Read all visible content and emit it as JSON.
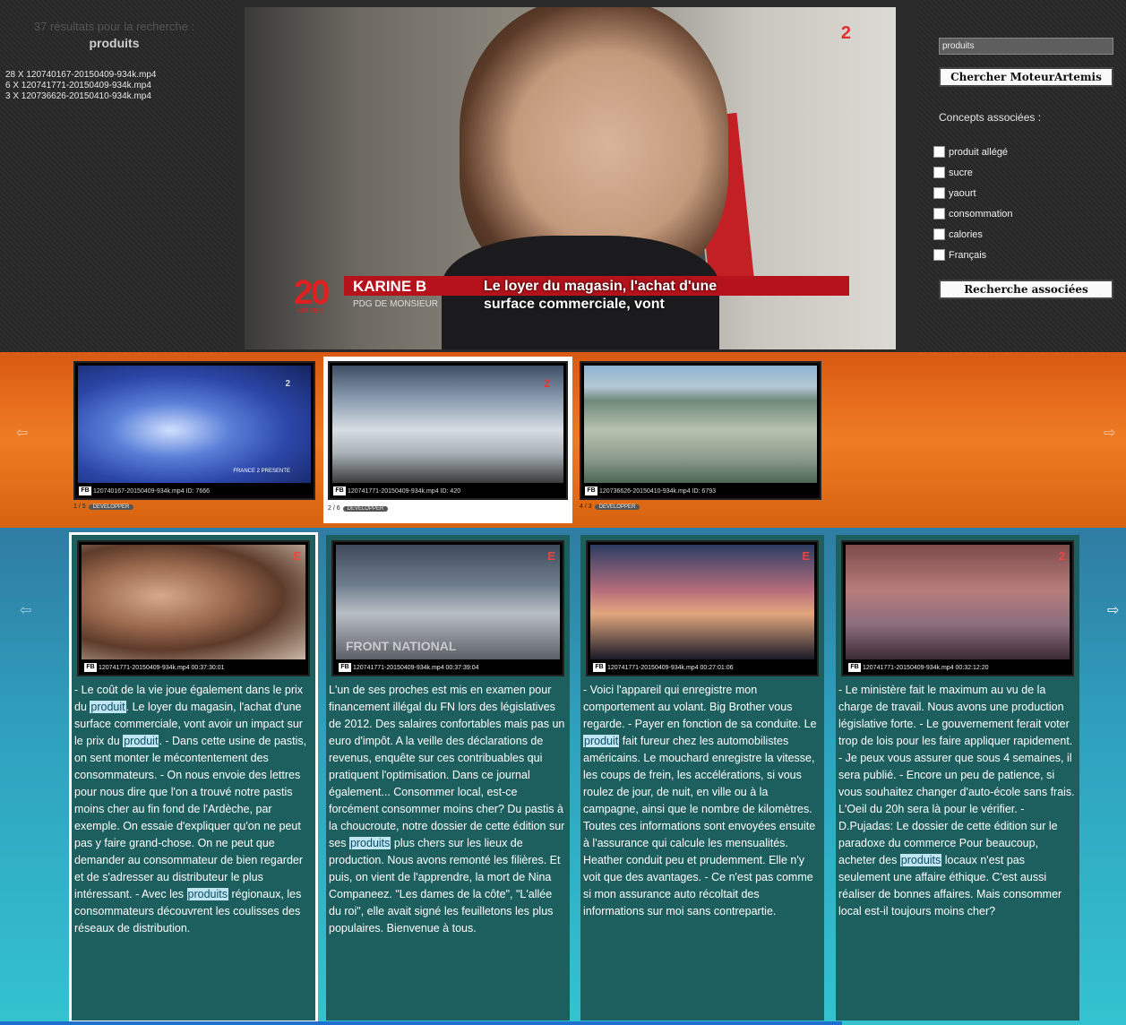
{
  "left_panel": {
    "results_count": "37 résultats pour la recherche :",
    "query": "produits",
    "files": [
      "28 X 120740167-20150409-934k.mp4",
      "6 X 120741771-20150409-934k.mp4",
      "3 X 120736626-20150410-934k.mp4"
    ]
  },
  "video": {
    "channel": "2",
    "show_number": "20",
    "show_sub": "HEURES",
    "speaker_name": "KARINE B",
    "speaker_role": "PDG DE MONSIEUR",
    "caption_line1": "Le loyer du magasin, l'achat d'une",
    "caption_line2": "surface commerciale, vont"
  },
  "right_panel": {
    "search_value": "produits",
    "search_button": "Chercher MoteurArtemis",
    "concepts_label": "Concepts associées :",
    "concepts": [
      "produit allégé",
      "sucre",
      "yaourt",
      "consommation",
      "calories",
      "Français"
    ],
    "related_button": "Recherche associées"
  },
  "orange_strip": {
    "left_arrow": "⇦",
    "right_arrow": "⇨",
    "clips": [
      {
        "logo": "FB",
        "meta": "120740167-20150409-934k.mp4 ID: 7666",
        "index": "1 / 5",
        "overlay": "FRANCE 2 PRESENTE",
        "channel": "2",
        "develop": "DEVELOPPER"
      },
      {
        "logo": "FB",
        "meta": "120741771-20150409-934k.mp4 ID: 420",
        "index": "2 / 6",
        "overlay": "",
        "channel": "2",
        "develop": "DEVELOPPER"
      },
      {
        "logo": "FB",
        "meta": "120736626-20150410-934k.mp4 ID: 6793",
        "index": "4 / 3",
        "overlay": "",
        "channel": "",
        "develop": "DEVELOPPER"
      }
    ]
  },
  "teal_strip": {
    "left_arrow": "⇦",
    "right_arrow": "⇨",
    "columns": [
      {
        "logo": "FB",
        "meta": "120741771-20150409-934k.mp4 00:37:30:01",
        "channel": "E",
        "overlay": "",
        "segments": [
          {
            "text": "- Le coût de la vie joue également dans le prix du "
          },
          {
            "text": "produit",
            "hl": true
          },
          {
            "text": ". Le loyer du magasin, l'achat d'une surface commerciale, vont avoir un impact sur le prix du "
          },
          {
            "text": "produit",
            "hl": true
          },
          {
            "text": ". - Dans cette usine de pastis, on sent monter le mécontentement des consommateurs. - On nous envoie des lettres pour nous dire que l'on a trouvé notre pastis moins cher au fin fond de l'Ardèche, par exemple. On essaie d'expliquer qu'on ne peut pas y faire grand-chose. On ne peut que demander au consommateur de bien regarder et de s'adresser au distributeur le plus intéressant. - Avec les "
          },
          {
            "text": "produits",
            "hl": true
          },
          {
            "text": " régionaux, les consommateurs découvrent les coulisses des réseaux de distribution."
          }
        ]
      },
      {
        "logo": "FB",
        "meta": "120741771-20150409-934k.mp4 00:37:39:04",
        "channel": "E",
        "overlay": "FRONT NATIONAL",
        "segments": [
          {
            "text": "L'un de ses proches est mis en examen pour financement illégal du FN lors des législatives de 2012. Des salaires confortables mais pas un euro d'impôt. A la veille des déclarations de revenus, enquête sur ces contribuables qui pratiquent l'optimisation. Dans ce journal également... Consommer local, est-ce forcément consommer moins cher? Du pastis à la choucroute, notre dossier de cette édition sur ses "
          },
          {
            "text": "produits",
            "hl": true
          },
          {
            "text": " plus chers sur les lieux de production. Nous avons remonté les filières. Et puis, on vient de l'apprendre, la mort de Nina Companeez. \"Les dames de la côte\", \"L'allée du roi\", elle avait signé les feuilletons les plus populaires. Bienvenue à tous."
          }
        ]
      },
      {
        "logo": "FB",
        "meta": "120741771-20150409-934k.mp4 00:27:01:06",
        "channel": "E",
        "overlay": "",
        "segments": [
          {
            "text": "- Voici l'appareil qui enregistre mon comportement au volant. Big Brother vous regarde. - Payer en fonction de sa conduite. Le "
          },
          {
            "text": "produit",
            "hl": true
          },
          {
            "text": " fait fureur chez les automobilistes américains. Le mouchard enregistre la vitesse, les coups de frein, les accélérations, si vous roulez de jour, de nuit, en ville ou à la campagne, ainsi que le nombre de kilomètres. Toutes ces informations sont envoyées ensuite à l'assurance qui calcule les mensualités. Heather conduit peu et prudemment. Elle n'y voit que des avantages. - Ce n'est pas comme si mon assurance auto récoltait des informations sur moi sans contrepartie."
          }
        ]
      },
      {
        "logo": "FB",
        "meta": "120741771-20150409-934k.mp4 00:32:12:20",
        "channel": "2",
        "overlay": "",
        "segments": [
          {
            "text": "- Le ministère fait le maximum au vu de la charge de travail. Nous avons une production législative forte. - Le gouvernement ferait voter trop de lois pour les faire appliquer rapidement. - Je peux vous assurer que sous 4 semaines, il sera publié. - Encore un peu de patience, si vous souhaitez changer d'auto-école sans frais. L'Oeil du 20h sera là pour le vérifier. -D.Pujadas: Le dossier de cette édition sur le paradoxe du commerce Pour beaucoup, acheter des "
          },
          {
            "text": "produits",
            "hl": true
          },
          {
            "text": " locaux n'est pas seulement une affaire éthique. C'est aussi réaliser de bonnes affaires. Mais consommer local est-il toujours moins cher?"
          }
        ]
      }
    ]
  }
}
